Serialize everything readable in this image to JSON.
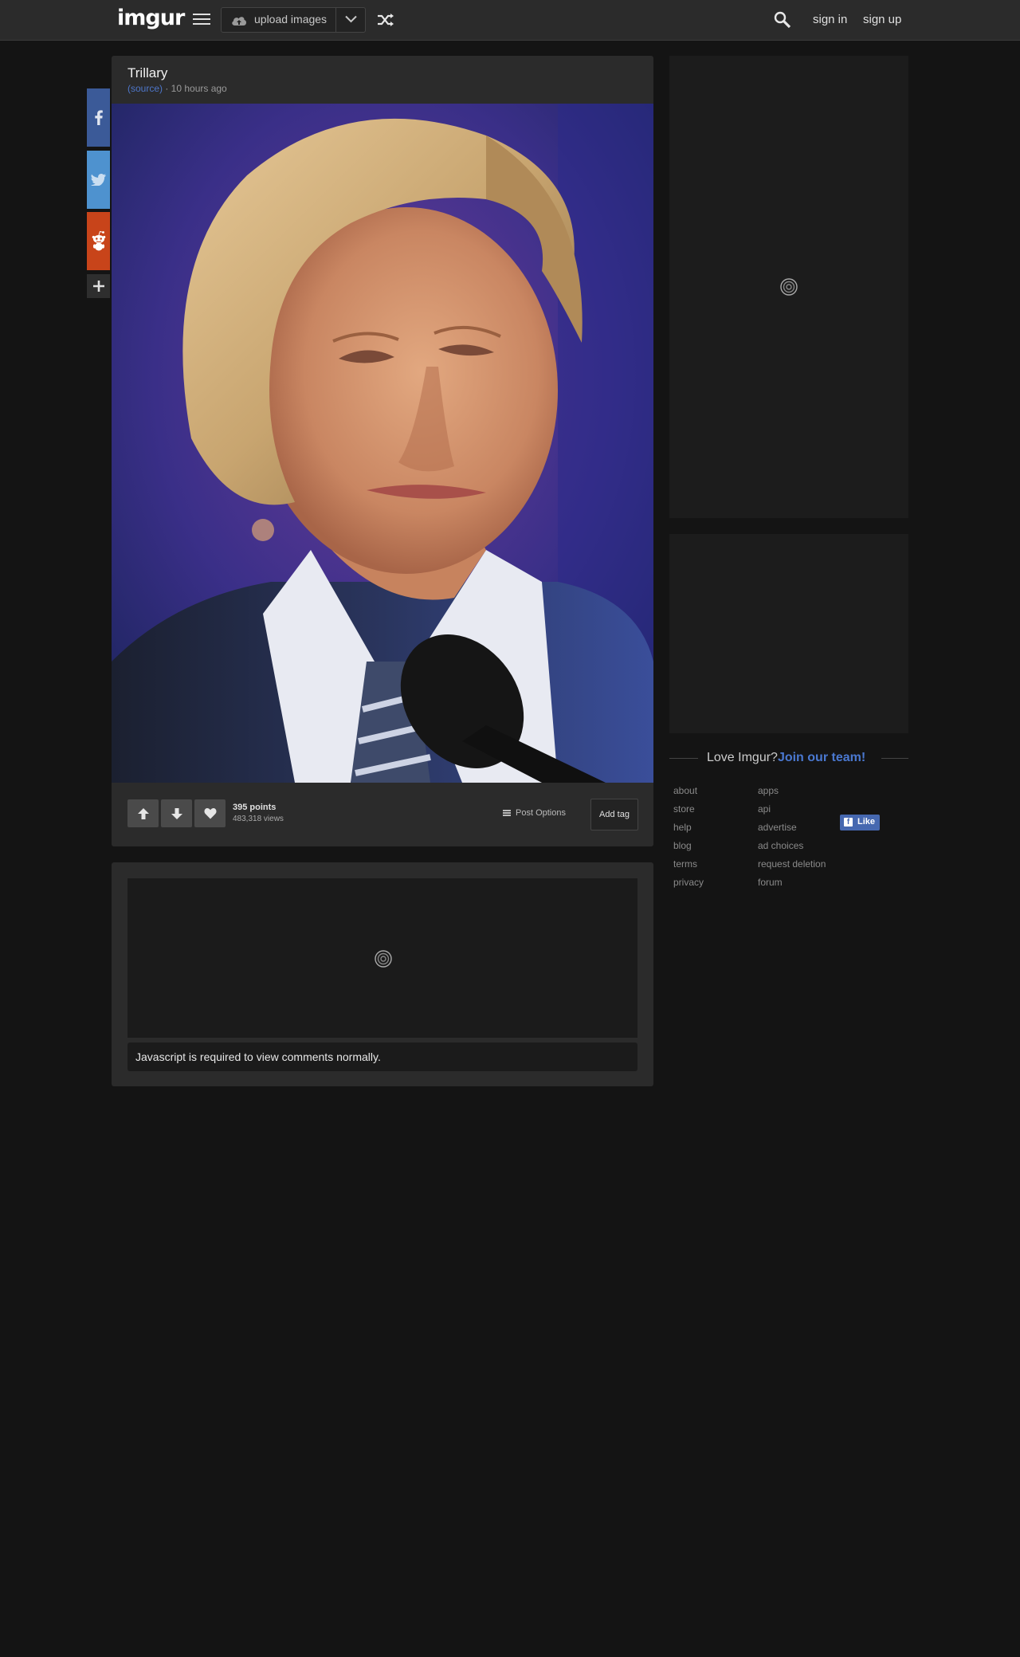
{
  "header": {
    "logo": "imgur",
    "upload_label": "upload images",
    "sign_in": "sign in",
    "sign_up": "sign up"
  },
  "post": {
    "title": "Trillary",
    "source_label": "(source)",
    "age": " · 10 hours ago",
    "points": "395 points",
    "views": "483,318 views",
    "post_options": "Post Options",
    "add_tag": "Add tag"
  },
  "comments": {
    "js_required": "Javascript is required to view comments normally."
  },
  "sidebar": {
    "love_text": "Love Imgur?",
    "join_text": "Join our team!",
    "links_col1": [
      "about",
      "store",
      "help",
      "blog",
      "terms",
      "privacy"
    ],
    "links_col2": [
      "apps",
      "api",
      "advertise",
      "ad choices",
      "request deletion",
      "forum"
    ],
    "fb_like": "Like"
  },
  "colors": {
    "background": "#141414",
    "panel": "#2b2b2b",
    "facebook": "#3b5a98",
    "twitter": "#4e92cf",
    "reddit": "#c8441a",
    "link_accent": "#4a78d0"
  },
  "icons": [
    "menu-icon",
    "cloud-upload-icon",
    "chevron-down-icon",
    "shuffle-icon",
    "search-icon",
    "facebook-icon",
    "twitter-icon",
    "reddit-icon",
    "plus-icon",
    "upvote-icon",
    "downvote-icon",
    "heart-icon"
  ]
}
